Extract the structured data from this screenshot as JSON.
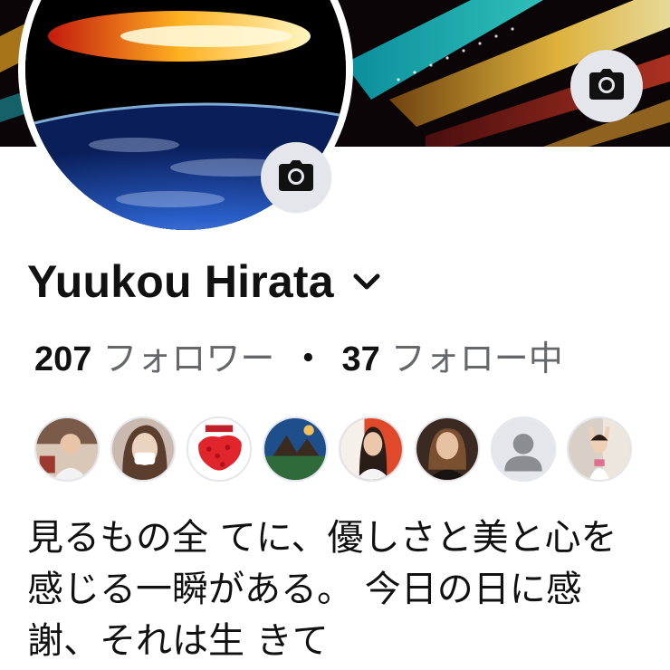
{
  "profile": {
    "name": "Yuukou Hirata",
    "followers_count": "207",
    "followers_label": "フォロワー",
    "separator": "・",
    "following_count": "37",
    "following_label": "フォロー中",
    "bio": "見るもの全 てに、優しさと美と心を 感じる一瞬がある。 今日の日に感謝、それは生 きて"
  },
  "icons": {
    "cover_camera": "camera-icon",
    "avatar_camera": "camera-icon",
    "name_dropdown": "chevron-down-icon",
    "placeholder_friend": "person-silhouette-icon"
  },
  "friends": [
    {
      "name": "friend-1"
    },
    {
      "name": "friend-2"
    },
    {
      "name": "friend-3"
    },
    {
      "name": "friend-4"
    },
    {
      "name": "friend-5"
    },
    {
      "name": "friend-6"
    },
    {
      "name": "friend-7"
    },
    {
      "name": "friend-8"
    }
  ],
  "colors": {
    "button_gray": "#e4e6eb",
    "secondary_text": "#65676b",
    "primary_text": "#111111"
  }
}
